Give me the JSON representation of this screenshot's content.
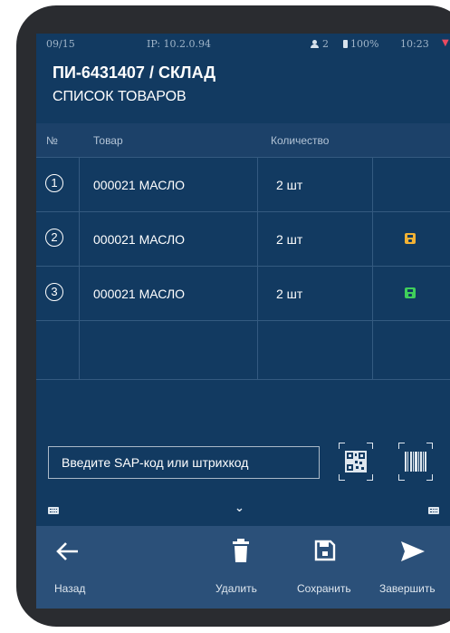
{
  "status": {
    "page": "09/15",
    "ip": "IP: 10.2.0.94",
    "users": "2",
    "battery": "100%",
    "time": "10:23"
  },
  "header": {
    "title": "ПИ-6431407 / СКЛАД",
    "subtitle": "СПИСОК ТОВАРОВ"
  },
  "table": {
    "columns": [
      "№",
      "Товар",
      "Количество"
    ],
    "rows": [
      {
        "num": "1",
        "product": "000021 МАСЛО",
        "qty": "2 шт",
        "saved": "none"
      },
      {
        "num": "2",
        "product": "000021 МАСЛО",
        "qty": "2 шт",
        "saved": "pending"
      },
      {
        "num": "3",
        "product": "000021 МАСЛО",
        "qty": "2 шт",
        "saved": "done"
      }
    ]
  },
  "search": {
    "placeholder": "Введите SAP-код или штрихкод",
    "value": ""
  },
  "colors": {
    "background": "#123a61",
    "header_row": "#1c4169",
    "bottom_bar": "#2b5079",
    "save_pending": "#f2b234",
    "save_done": "#3fcf5a"
  },
  "toolbar": {
    "back_label": "Назад",
    "delete_label": "Удалить",
    "save_label": "Сохранить",
    "finish_label": "Завершить"
  }
}
